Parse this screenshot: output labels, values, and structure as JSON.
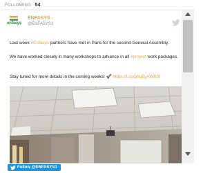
{
  "header": {
    "following_label": "FOLLOWING:",
    "following_count": "54"
  },
  "tweet": {
    "avatar_logo_text": "enfasys",
    "author_name": "ENFASYS -",
    "author_handle": "@ENFASYS1",
    "paragraph1": {
      "before": "Last week ",
      "hashtag": "#Enfasys",
      "after": " partners have met in Paris for the second General Assembly."
    },
    "paragraph2": {
      "before": "We have worked closely in many workshops to advance in all ",
      "hashtag": "#project",
      "after": " work packages."
    },
    "paragraph3": {
      "before": " Stay tuned for more details in the coming weeks! ",
      "emoji": "🚀",
      "link": " https://t.co/phqZyAWB3f"
    },
    "icons": {
      "twitter": "twitter-bird-icon"
    }
  },
  "follow_button": {
    "label": "Follow @ENFASYS1"
  },
  "colors": {
    "accent_orange": "#e9a23b",
    "twitter_blue": "#1b95e0",
    "brand_green": "#2f8a3a"
  }
}
